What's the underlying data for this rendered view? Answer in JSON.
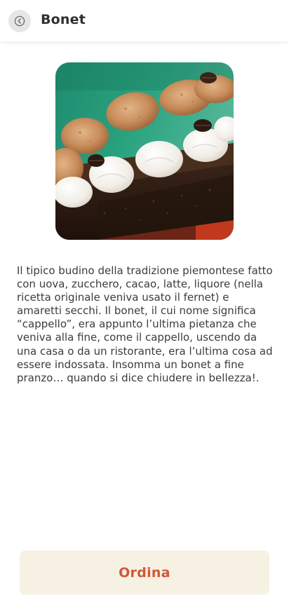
{
  "header": {
    "back_icon": "chevron-left-circle-icon",
    "title": "Bonet"
  },
  "product": {
    "image_subject": "bonet-dessert-photo",
    "description": "Il tipico budino della tradizione piemontese fatto con uova, zucchero, cacao, latte, liquore (nella ricetta originale veniva usato il fernet) e amaretti secchi. Il bonet, il cui nome significa “cappello”, era appunto l’ultima pietanza che veniva alla fine, come il cappello, uscendo da una casa o da un ristorante, era l’ultima cosa ad essere indossata. Insomma un bonet a fine pranzo… quando si dice chiudere in bellezza!."
  },
  "actions": {
    "order_label": "Ordina"
  },
  "colors": {
    "accent": "#d0583a",
    "button_bg": "#f6f1e2",
    "back_button_bg": "#e6e6e6"
  }
}
